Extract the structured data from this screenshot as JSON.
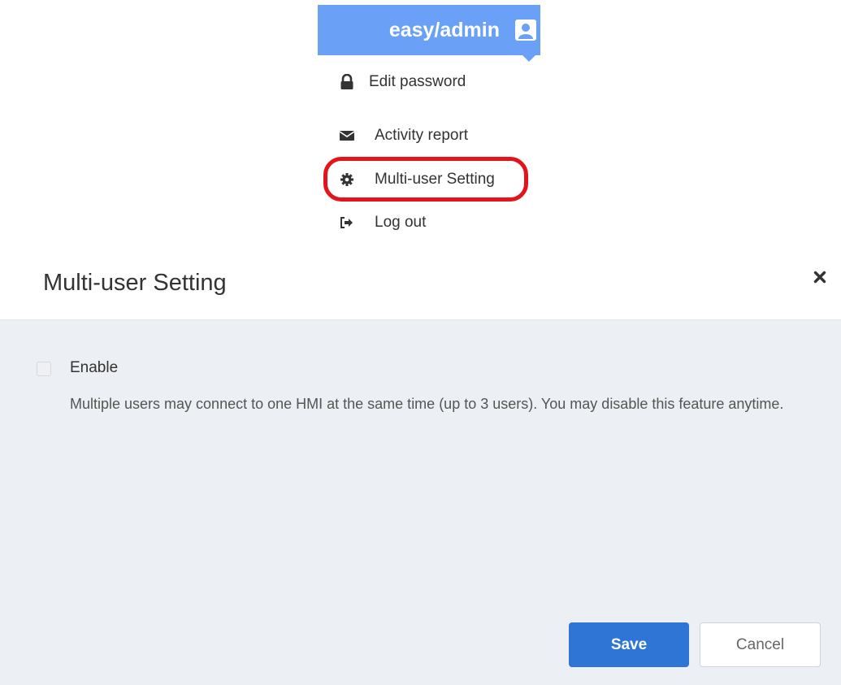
{
  "user_menu": {
    "username": "easy/admin",
    "header_color": "#6aa0f5",
    "items": [
      {
        "label": "Edit password",
        "icon": "lock-icon"
      },
      {
        "label": "Activity report",
        "icon": "envelope-icon"
      },
      {
        "label": "Multi-user Setting",
        "icon": "gear-icon",
        "highlighted": true
      },
      {
        "label": "Log out",
        "icon": "logout-icon"
      }
    ],
    "highlight_color": "#e3141c"
  },
  "dialog": {
    "title": "Multi-user Setting",
    "enable_label": "Enable",
    "enable_checked": false,
    "description": "Multiple users may connect to one HMI at the same time (up to 3 users). You may disable this feature anytime.",
    "save_label": "Save",
    "cancel_label": "Cancel",
    "accent_color": "#2e75d6"
  }
}
